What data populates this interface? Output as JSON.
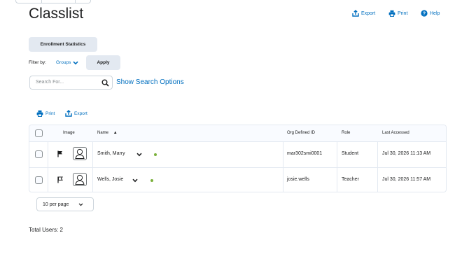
{
  "page": {
    "title": "Classlist"
  },
  "header_actions": {
    "export": "Export",
    "print": "Print",
    "help": "Help"
  },
  "enrollment_statistics": "Enrollment Statistics",
  "filter": {
    "label": "Filter by:",
    "value": "Groups",
    "apply": "Apply"
  },
  "search": {
    "placeholder": "Search For...",
    "show_options": "Show Search Options"
  },
  "table_actions": {
    "print": "Print",
    "export": "Export"
  },
  "table": {
    "headers": {
      "image": "Image",
      "name": "Name",
      "org_id": "Org Defined ID",
      "role": "Role",
      "last_accessed": "Last Accessed"
    },
    "rows": [
      {
        "name": "Smith, Marry",
        "org_id": "mar302smi0001",
        "role": "Student",
        "last_accessed": "Jul 30, 2026 11:13 AM",
        "flag": "filled-flag-icon"
      },
      {
        "name": "Wells, Josie",
        "org_id": "josie.wells",
        "role": "Teacher",
        "last_accessed": "Jul 30, 2026 11:57 AM",
        "flag": "outline-flag-icon"
      }
    ]
  },
  "pagination": {
    "per_page": "10 per page"
  },
  "footer": {
    "total_users": "Total Users: 2"
  },
  "colors": {
    "link": "#006fbf",
    "button_bg": "#e3e9f1",
    "online_dot": "#7bb13c"
  }
}
